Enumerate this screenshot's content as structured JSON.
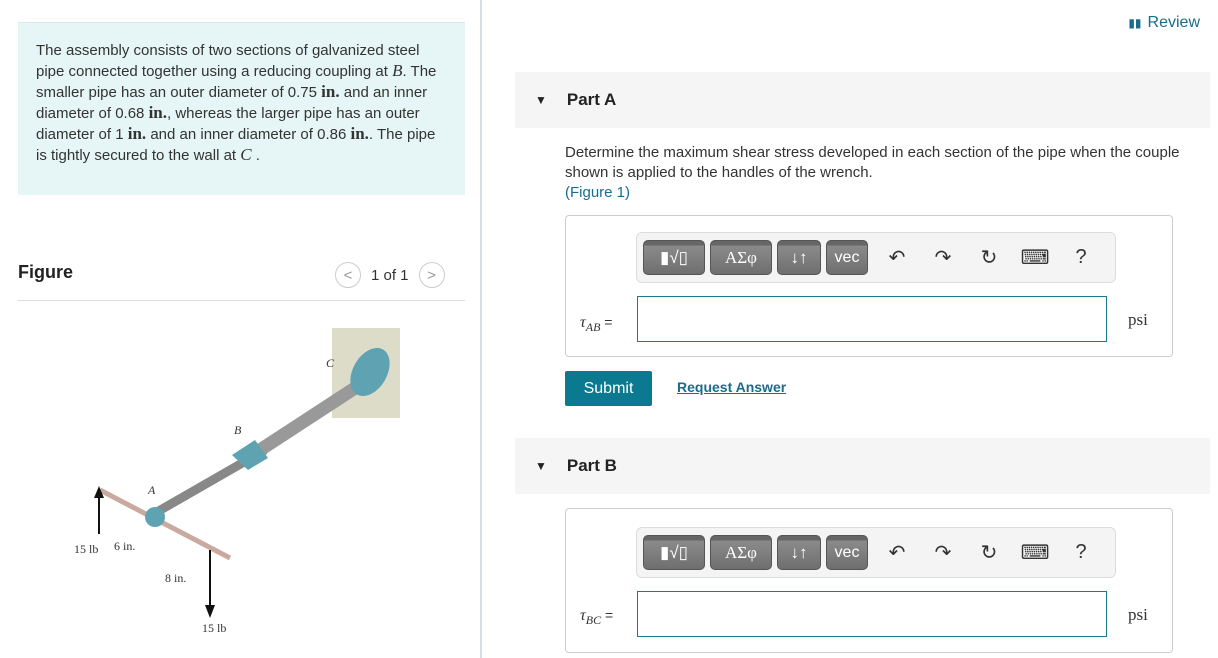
{
  "problem": {
    "text_parts": [
      "The assembly consists of two sections of galvanized steel pipe connected together using a reducing coupling at ",
      "B",
      ". The smaller pipe has an outer diameter of 0.75 ",
      "in.",
      " and an inner diameter of 0.68 ",
      "in.",
      ", whereas the larger pipe has an outer diameter of 1 ",
      "in.",
      " and an inner diameter of 0.86 ",
      "in.",
      ". The pipe is tightly secured to the wall at ",
      "C",
      " ."
    ]
  },
  "figure": {
    "heading": "Figure",
    "pager": "1 of 1",
    "labels": {
      "A": "A",
      "B": "B",
      "C": "C",
      "f1": "15 lb",
      "f2": "15 lb",
      "d1": "6 in.",
      "d2": "8 in."
    }
  },
  "review": "Review",
  "partA": {
    "title": "Part A",
    "desc": "Determine the maximum shear stress developed in each section of the pipe when the couple shown is applied to the handles of the wrench.",
    "figlink": "(Figure 1)",
    "label_sym": "τ",
    "label_sub": "AB",
    "eq": " =",
    "value": "",
    "unit": "psi",
    "submit": "Submit",
    "request": "Request Answer"
  },
  "partB": {
    "title": "Part B",
    "label_sym": "τ",
    "label_sub": "BC",
    "eq": " =",
    "value": "",
    "unit": "psi"
  },
  "toolbar": {
    "templates": "▮√▯",
    "greek": "ΑΣφ",
    "arrows": "↓↑",
    "vec": "vec",
    "undo": "↶",
    "redo": "↷",
    "reset": "↻",
    "keyboard": "⌨",
    "help": "?"
  },
  "colors": {
    "accent": "#0b7a91",
    "info_bg": "#e6f5f5",
    "link": "#1a6c8c"
  }
}
